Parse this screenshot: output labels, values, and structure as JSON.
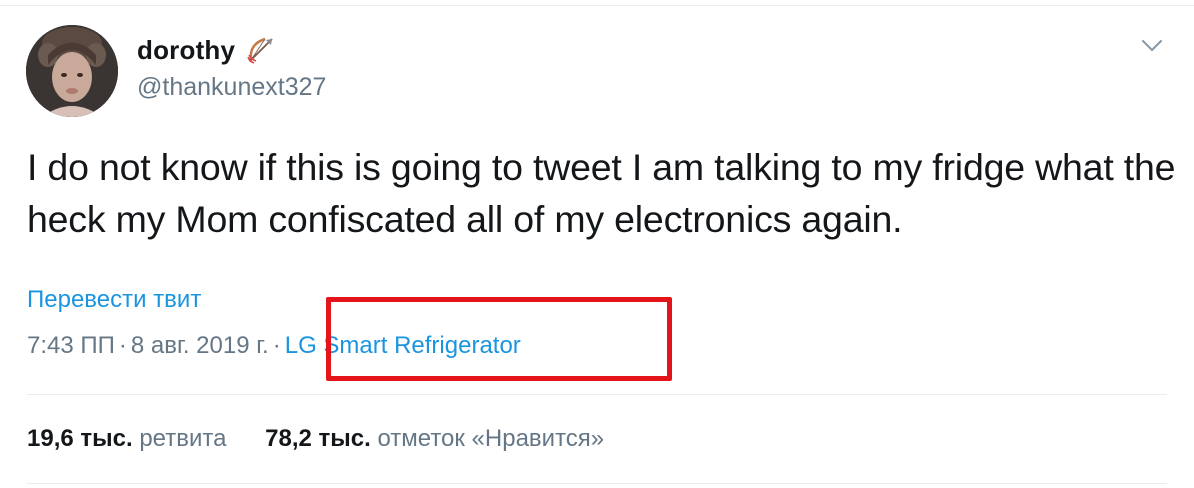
{
  "user": {
    "display_name": "dorothy",
    "name_emoji_icon": "bow-and-arrow-icon",
    "handle": "@thankunext327"
  },
  "tweet": {
    "text": "I do not know if this is going to tweet I am talking to my fridge what the heck my Mom confiscated all of my electronics again.",
    "translate_label": "Перевести твит",
    "time": "7:43 ПП",
    "date": "8 авг. 2019 г.",
    "separator": "·",
    "source": "LG Smart Refrigerator"
  },
  "stats": {
    "retweets_count": "19,6 тыс.",
    "retweets_label": "ретвита",
    "likes_count": "78,2 тыс.",
    "likes_label": "отметок «Нравится»"
  },
  "colors": {
    "link": "#1b95e0",
    "secondary_text": "#657786",
    "highlight_box": "#e3141a"
  }
}
